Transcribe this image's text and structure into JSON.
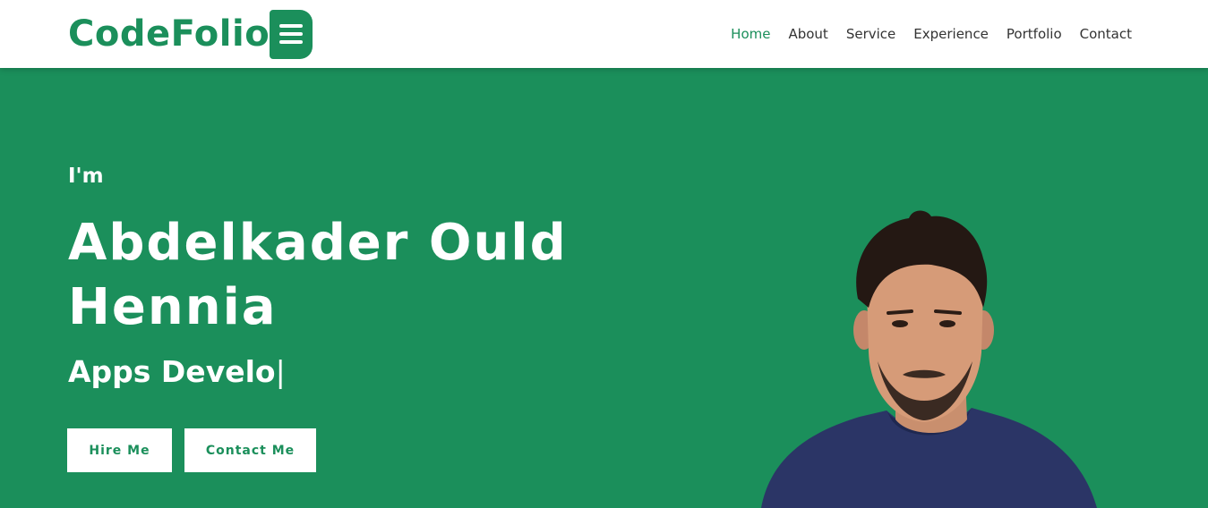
{
  "brand": {
    "name": "CodeFolio",
    "accent": "#1b8f5b"
  },
  "nav": {
    "items": [
      {
        "label": "Home",
        "active": true
      },
      {
        "label": "About",
        "active": false
      },
      {
        "label": "Service",
        "active": false
      },
      {
        "label": "Experience",
        "active": false
      },
      {
        "label": "Portfolio",
        "active": false
      },
      {
        "label": "Contact",
        "active": false
      }
    ]
  },
  "hero": {
    "intro": "I'm",
    "name_line1": "Abdelkader Ould",
    "name_line2": "Hennia",
    "role": "Apps Develo",
    "caret": "|",
    "hire_label": "Hire Me",
    "contact_label": "Contact Me",
    "portrait_icon": "person-portrait"
  }
}
